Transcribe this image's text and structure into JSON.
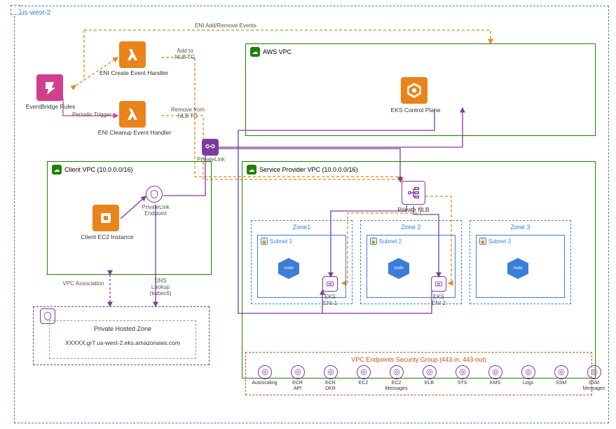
{
  "region": "us-west-2",
  "events_label": "ENI Add/Remove Events",
  "eventbridge": "EventBridge Rules",
  "periodic_trigger": "Periodic Trigger",
  "eni_create": "ENI Create Event Handler",
  "eni_cleanup": "ENI Cleanup Event Handler",
  "add_to": "Add to",
  "nlb_tg": "NLB TG",
  "remove_from": "Remove from",
  "aws_vpc": "AWS VPC",
  "eks_cp": "EKS Control Plane",
  "client_vpc": "Client VPC (10.0.0.0/16)",
  "privatelink": "PrivateLink",
  "pl_endpoint": "PrivateLink\nEndpoint",
  "client_ec2": "Client EC2 Instance",
  "provider_vpc": "Service Provider VPC (10.0.0.0/16)",
  "private_nlb": "Private NLB",
  "zones": [
    "Zone1",
    "Zone 2",
    "Zone 3"
  ],
  "subnets": [
    "Subnet 1",
    "Subnet 2",
    "Subnet 3"
  ],
  "node": "node",
  "eks_eni1": "EKS\nENI 1",
  "eks_eni2": "EKS\nENI 2",
  "vpc_assoc": "VPC Association",
  "dns_lookup": "DNS\nLookup\n(kubectl)",
  "phz": "Private Hosted Zone",
  "phz_dns": "XXXXX.gr7.us-west-2.eks.amazonaws.com",
  "sec_group": "VPC Endpoints Security Group (443-in, 443-out)",
  "endpoints": [
    "Autoscaling",
    "ECR\nAPI",
    "ECR\nDKR",
    "EC2",
    "EC2\nMessages",
    "ELB",
    "STS",
    "KMS",
    "Logs",
    "SSM",
    "SSM\nMessages"
  ]
}
